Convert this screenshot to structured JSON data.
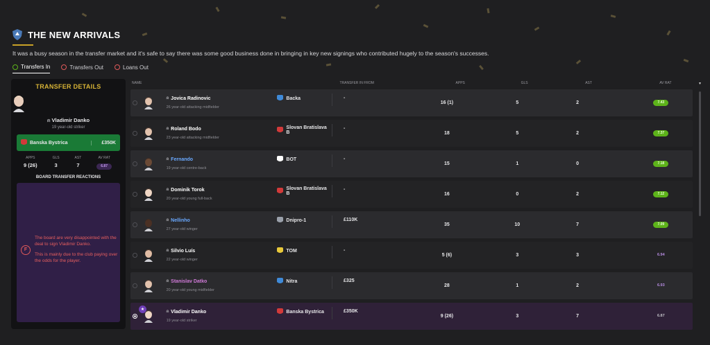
{
  "header": {
    "title": "THE NEW ARRIVALS",
    "description": "It was a busy season in the transfer market and it's safe to say there was some good business done in bringing in key new signings who contributed hugely to the season's successes."
  },
  "tabs": [
    {
      "label": "Transfers In",
      "active": true,
      "color": "#5db31a"
    },
    {
      "label": "Transfers Out",
      "active": false,
      "color": "#e05a5a"
    },
    {
      "label": "Loans Out",
      "active": false,
      "color": "#e05a5a"
    }
  ],
  "panel": {
    "title": "TRANSFER DETAILS",
    "player_name": "Vladimir Danko",
    "player_desc": "19 year-old striker",
    "club": "Banska Bystrica",
    "fee": "£350K",
    "stats": [
      {
        "label": "APPS",
        "value": "9 (26)"
      },
      {
        "label": "GLS",
        "value": "3"
      },
      {
        "label": "AST",
        "value": "7"
      },
      {
        "label": "AV RAT",
        "value": "6.87"
      }
    ],
    "board_title": "BOARD TRANSFER REACTIONS",
    "board_grade": "F",
    "board_text_1": "The board are very disappointed with the deal to sign Vladimir Danko.",
    "board_text_2": "This is mainly due to the club paying over the odds for the player."
  },
  "table": {
    "headers": {
      "name": "NAME",
      "from": "TRANSFER IN FROM",
      "apps": "APPS",
      "gls": "GLS",
      "ast": "AST",
      "av": "AV RAT",
      "sort_icon": "▾"
    },
    "rows": [
      {
        "name": "Jovica Radinovic",
        "desc": "26 year-old attacking midfielder",
        "club": "Backa",
        "fee": "-",
        "apps": "16 (1)",
        "gls": "5",
        "ast": "2",
        "rating": "7.43",
        "rating_style": "green",
        "name_style": ""
      },
      {
        "name": "Roland Bodo",
        "desc": "23 year-old attacking midfielder",
        "club": "Slovan Bratislava B",
        "fee": "-",
        "apps": "18",
        "gls": "5",
        "ast": "2",
        "rating": "7.37",
        "rating_style": "green",
        "name_style": ""
      },
      {
        "name": "Fernando",
        "desc": "19 year-old centre-back",
        "club": "BOT",
        "fee": "-",
        "apps": "15",
        "gls": "1",
        "ast": "0",
        "rating": "7.18",
        "rating_style": "green",
        "name_style": "blue"
      },
      {
        "name": "Dominik Torok",
        "desc": "20 year-old young full-back",
        "club": "Slovan Bratislava B",
        "fee": "-",
        "apps": "16",
        "gls": "0",
        "ast": "2",
        "rating": "7.12",
        "rating_style": "green",
        "name_style": ""
      },
      {
        "name": "Nellinho",
        "desc": "27 year-old winger",
        "club": "Dnipro-1",
        "fee": "£110K",
        "apps": "35",
        "gls": "10",
        "ast": "7",
        "rating": "7.09",
        "rating_style": "green",
        "name_style": "blue"
      },
      {
        "name": "Silvio Luís",
        "desc": "22 year-old winger",
        "club": "TOM",
        "fee": "-",
        "apps": "5 (6)",
        "gls": "3",
        "ast": "3",
        "rating": "6.94",
        "rating_style": "plain",
        "name_style": ""
      },
      {
        "name": "Stanislav Datko",
        "desc": "20 year-old young midfielder",
        "club": "Nitra",
        "fee": "£325",
        "apps": "28",
        "gls": "1",
        "ast": "2",
        "rating": "6.93",
        "rating_style": "plain",
        "name_style": "pink"
      },
      {
        "name": "Vladimir Danko",
        "desc": "19 year-old striker",
        "club": "Banska Bystrica",
        "fee": "£350K",
        "apps": "9 (26)",
        "gls": "3",
        "ast": "7",
        "rating": "6.87",
        "rating_style": "plain white",
        "name_style": "",
        "selected": true
      }
    ]
  }
}
